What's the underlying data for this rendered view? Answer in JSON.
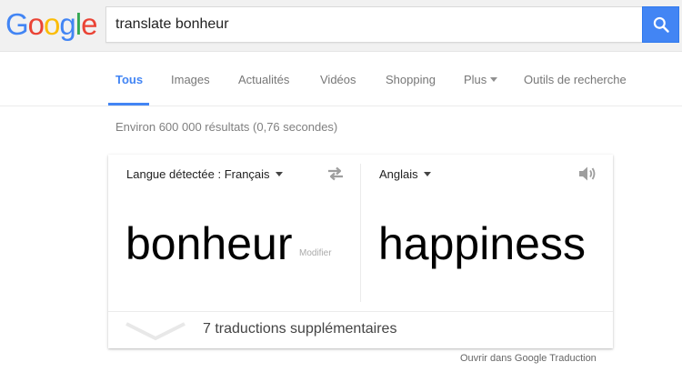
{
  "header": {
    "logo_letters": [
      {
        "char": "G",
        "color": "#4285f4"
      },
      {
        "char": "o",
        "color": "#ea4335"
      },
      {
        "char": "o",
        "color": "#fbbc05"
      },
      {
        "char": "g",
        "color": "#4285f4"
      },
      {
        "char": "l",
        "color": "#34a853"
      },
      {
        "char": "e",
        "color": "#ea4335"
      }
    ],
    "search_value": "translate bonheur",
    "search_icon": "search-icon",
    "accent_color": "#4285f4"
  },
  "tabs": {
    "items": [
      {
        "label": "Tous",
        "active": true
      },
      {
        "label": "Images",
        "active": false
      },
      {
        "label": "Actualités",
        "active": false
      },
      {
        "label": "Vidéos",
        "active": false
      },
      {
        "label": "Shopping",
        "active": false
      },
      {
        "label": "Plus",
        "active": false
      },
      {
        "label": "Outils de recherche",
        "active": false
      }
    ]
  },
  "result_stats": "Environ 600 000 résultats (0,76 secondes)",
  "translate": {
    "source_lang": "Langue détectée : Français",
    "target_lang": "Anglais",
    "source_word": "bonheur",
    "modify_label": "Modifier",
    "target_word": "happiness",
    "more_translations": "7 traductions supplémentaires",
    "open_in_translate": "Ouvrir dans Google Traduction",
    "swap_icon": "swap-languages-icon",
    "speaker_icon": "speaker-icon",
    "expand_icon": "chevron-down-icon"
  }
}
